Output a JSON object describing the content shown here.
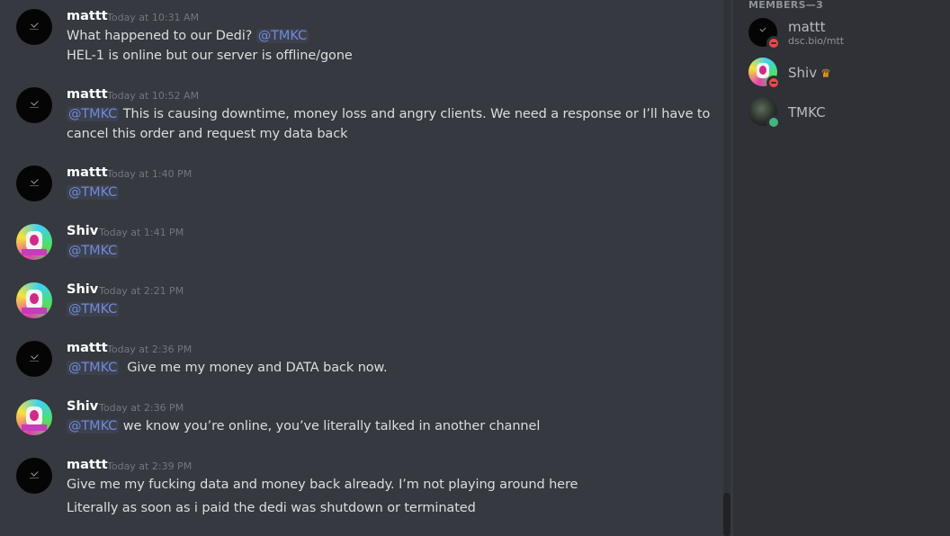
{
  "chat": {
    "messages": [
      {
        "author": "mattt",
        "timestamp": "Today at 10:31 AM",
        "avatar": "mattt-avatar",
        "lines": [
          {
            "mention": "",
            "text": "What happened to our Dedi? ",
            "mention_after": "@TMKC"
          },
          {
            "mention": "",
            "text": "HEL-1 is online but our server is offline/gone",
            "mention_after": ""
          }
        ]
      },
      {
        "author": "mattt",
        "timestamp": "Today at 10:52 AM",
        "avatar": "mattt-avatar",
        "lines": [
          {
            "mention": "@TMKC",
            "text": " This is causing downtime, money loss and angry clients. We need a response or I’ll have to",
            "mention_after": ""
          },
          {
            "mention": "",
            "text": "cancel this order and request my data back",
            "mention_after": ""
          }
        ]
      },
      {
        "author": "mattt",
        "timestamp": "Today at 1:40 PM",
        "avatar": "mattt-avatar",
        "lines": [
          {
            "mention": "@TMKC",
            "text": "",
            "mention_after": ""
          }
        ]
      },
      {
        "author": "Shiv",
        "timestamp": "Today at 1:41 PM",
        "avatar": "shiv-avatar",
        "lines": [
          {
            "mention": "@TMKC",
            "text": "",
            "mention_after": ""
          }
        ]
      },
      {
        "author": "Shiv",
        "timestamp": "Today at 2:21 PM",
        "avatar": "shiv-avatar",
        "lines": [
          {
            "mention": "@TMKC",
            "text": "",
            "mention_after": ""
          }
        ]
      },
      {
        "author": "mattt",
        "timestamp": "Today at 2:36 PM",
        "avatar": "mattt-avatar",
        "lines": [
          {
            "mention": "@TMKC",
            "text": "  Give me my money and DATA back now.",
            "mention_after": ""
          }
        ]
      },
      {
        "author": "Shiv",
        "timestamp": "Today at 2:36 PM",
        "avatar": "shiv-avatar",
        "lines": [
          {
            "mention": "@TMKC",
            "text": " we know you’re online, you’ve literally talked in another channel",
            "mention_after": ""
          }
        ]
      },
      {
        "author": "mattt",
        "timestamp": "Today at 2:39 PM",
        "avatar": "mattt-avatar",
        "lines": [
          {
            "mention": "",
            "text": "Give me my fucking data and money back already. I’m not playing around here",
            "mention_after": ""
          },
          {
            "mention": "",
            "text": "Literally as soon as i paid the dedi was shutdown or terminated",
            "mention_after": ""
          }
        ]
      }
    ]
  },
  "members": {
    "header": "MEMBERS—3",
    "list": [
      {
        "name": "mattt",
        "subtitle": "dsc.bio/mtt",
        "status": "dnd",
        "avatar": "mattt-avatar",
        "crown": false
      },
      {
        "name": "Shiv",
        "subtitle": "",
        "status": "dnd",
        "avatar": "shiv-avatar",
        "crown": true,
        "crown_icon": "crown-icon"
      },
      {
        "name": "TMKC",
        "subtitle": "",
        "status": "online",
        "avatar": "tmkc-avatar",
        "crown": false
      }
    ]
  },
  "colors": {
    "background": "#36393f",
    "sidebar": "#2f3136",
    "mention": "#7289da",
    "dnd": "#f04747",
    "online": "#43b581",
    "crown": "#faa61a"
  }
}
